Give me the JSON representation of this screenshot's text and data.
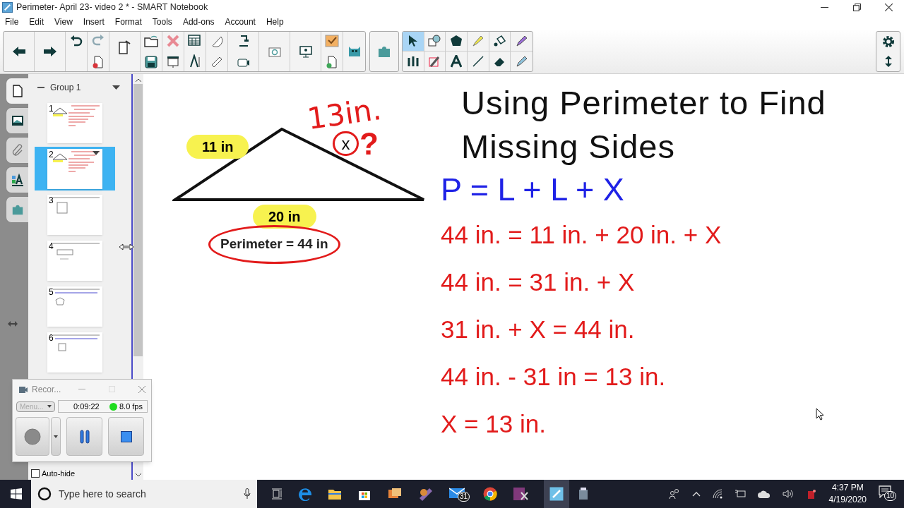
{
  "window": {
    "title": "Perimeter- April 23- video 2 * - SMART Notebook"
  },
  "menu": [
    "File",
    "Edit",
    "View",
    "Insert",
    "Format",
    "Tools",
    "Add-ons",
    "Account",
    "Help"
  ],
  "sidebar": {
    "tabs": [
      {
        "kind": "pages",
        "selected": true
      },
      {
        "kind": "gallery",
        "selected": false
      },
      {
        "kind": "attachments",
        "selected": false
      },
      {
        "kind": "properties",
        "selected": false
      },
      {
        "kind": "addons",
        "selected": false
      }
    ],
    "group": "Group 1",
    "pages": [
      {
        "number": "1",
        "selected": false
      },
      {
        "number": "2",
        "selected": true
      },
      {
        "number": "3",
        "selected": false
      },
      {
        "number": "4",
        "selected": false
      },
      {
        "number": "5",
        "selected": false
      },
      {
        "number": "6",
        "selected": false
      }
    ]
  },
  "slide": {
    "title_lines": [
      "Using Perimeter to Find",
      "Missing Sides"
    ],
    "formula": "P = L + L + X",
    "steps": [
      "44 in. = 11 in. + 20 in. + X",
      "44 in. = 31 in. + X",
      "31 in. + X = 44 in.",
      "44 in. - 31 in = 13 in.",
      "X = 13 in."
    ],
    "side_labels": [
      "11 in",
      "20 in"
    ],
    "perimeter_label": "Perimeter = 44 in",
    "handwriting": {
      "answer": "13in.",
      "unknown": "x",
      "question": "?"
    }
  },
  "recorder": {
    "title": "Recor...",
    "menu": "Menu...",
    "time": "0:09:22",
    "fps": "8.0 fps"
  },
  "auto_hide": {
    "label": "Auto-hide",
    "checked": false
  },
  "taskbar": {
    "search_placeholder": "Type here to search",
    "mail_badge": "31",
    "time": "4:37 PM",
    "date": "4/19/2020",
    "notifications": "10"
  }
}
